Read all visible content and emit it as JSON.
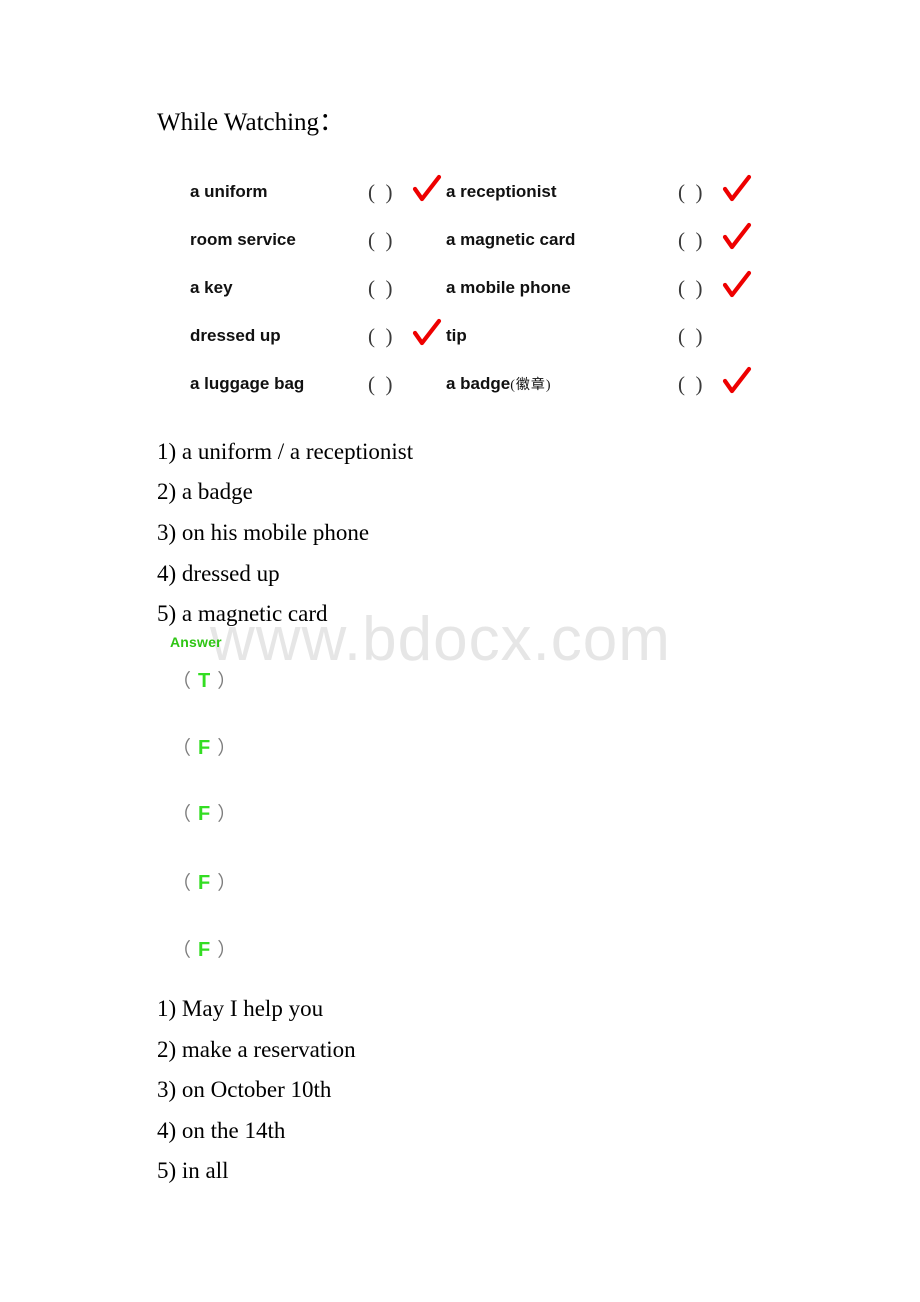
{
  "page": {
    "heading": "While Watching：",
    "watermark": "www.bdocx.com"
  },
  "checklist": {
    "open_paren": "(",
    "close_paren": ")",
    "rows": [
      {
        "left_label": "a uniform",
        "left_checked": true,
        "right_label": "a receptionist",
        "right_annotation": "",
        "right_checked": true
      },
      {
        "left_label": "room service",
        "left_checked": false,
        "right_label": "a magnetic card",
        "right_annotation": "",
        "right_checked": true
      },
      {
        "left_label": "a key",
        "left_checked": false,
        "right_label": "a mobile phone",
        "right_annotation": "",
        "right_checked": true
      },
      {
        "left_label": "dressed up",
        "left_checked": true,
        "right_label": "tip",
        "right_annotation": "",
        "right_checked": false
      },
      {
        "left_label": "a luggage bag",
        "left_checked": false,
        "right_label": "a badge",
        "right_annotation": "(徽章)",
        "right_checked": true
      }
    ]
  },
  "answers_first": [
    "1) a uniform / a receptionist",
    "2) a badge",
    "3) on his mobile phone",
    "4) dressed up",
    "5) a magnetic card"
  ],
  "answer_block": {
    "label": "Answer",
    "open_paren": "（",
    "close_paren": "）",
    "values": [
      "T",
      "F",
      "F",
      "F",
      "F"
    ]
  },
  "answers_second": [
    "1) May I help you",
    "2) make a reservation",
    "3) on October 10th",
    "4) on the 14th",
    "5) in all"
  ],
  "colors": {
    "tick_red": "#ee0000",
    "answer_label_green": "#2ec514",
    "tf_green": "#33dd22",
    "watermark_gray": "#e6e6e6"
  }
}
